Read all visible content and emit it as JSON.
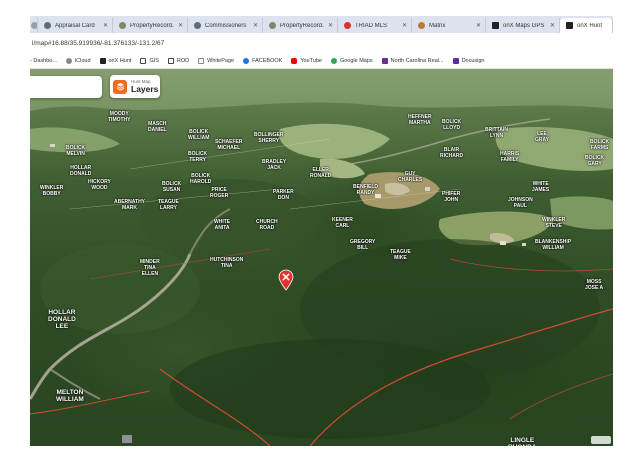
{
  "browser": {
    "tabs": [
      {
        "label": "",
        "icon": "page-icon",
        "color": "#9aa3ad"
      },
      {
        "label": "Appraisal Card",
        "icon": "globe-icon",
        "color": "#5f6b7a"
      },
      {
        "label": "PropertyRecord.a",
        "icon": "county-seal-icon",
        "color": "#7a8a6a"
      },
      {
        "label": "Commissioners",
        "icon": "globe-icon",
        "color": "#5f6b7a"
      },
      {
        "label": "PropertyRecord.a",
        "icon": "county-seal-icon",
        "color": "#7a8a6a"
      },
      {
        "label": "TRIAD MLS",
        "icon": "triad-icon",
        "color": "#d9342b"
      },
      {
        "label": "Matrix",
        "icon": "matrix-icon",
        "color": "#c0782b"
      },
      {
        "label": "onX Maps GPS H",
        "icon": "onx-icon",
        "color": "#222222"
      },
      {
        "label": "onX Hunt",
        "icon": "onx-icon",
        "color": "#222222",
        "active": true
      }
    ],
    "url": "l/map#16.88/35.919936/-81.376133/-131.2/67",
    "bookmarks": [
      {
        "label": "- Dashbo...",
        "icon": "dashboard-icon",
        "color": "#3b6fb6"
      },
      {
        "label": "iCloud",
        "icon": "apple-icon",
        "color": "#888888"
      },
      {
        "label": "onX Hunt",
        "icon": "onx-icon",
        "color": "#222222"
      },
      {
        "label": "GIS",
        "icon": "folder-icon",
        "color": "#444444"
      },
      {
        "label": "ROD",
        "icon": "folder-icon",
        "color": "#444444"
      },
      {
        "label": "WhitePage",
        "icon": "whitepages-icon",
        "color": "#ffffff"
      },
      {
        "label": "FACEBOOK",
        "icon": "facebook-icon",
        "color": "#1877f2"
      },
      {
        "label": "YouTube",
        "icon": "youtube-icon",
        "color": "#ff0000"
      },
      {
        "label": "Google Maps",
        "icon": "google-maps-icon",
        "color": "#34a853"
      },
      {
        "label": "North Carolina Real...",
        "icon": "nc-realtors-icon",
        "color": "#6b2d8f"
      },
      {
        "label": "Docusign",
        "icon": "docusign-icon",
        "color": "#5a2ea6"
      }
    ]
  },
  "map": {
    "layers_button": {
      "sub": "Hunt Map",
      "title": "Layers"
    },
    "marker_color": "#e5312b",
    "labels": [
      {
        "text": "MOODY\nTIMOTHY",
        "big": false
      },
      {
        "text": "MASCH\nDANIEL",
        "big": false
      },
      {
        "text": "BOLICK\nWILLIAM",
        "big": false
      },
      {
        "text": "SCHAEFER\nMICHAEL",
        "big": false
      },
      {
        "text": "BOLLINGER\nSHERRY",
        "big": false
      },
      {
        "text": "BOLICK\nTERRY",
        "big": false
      },
      {
        "text": "BRADLEY\nJACK",
        "big": false
      },
      {
        "text": "HEFFNER\nMARTHA",
        "big": false
      },
      {
        "text": "BOLICK\nLLOYD",
        "big": false
      },
      {
        "text": "BRITTAIN\nLYNN",
        "big": false
      },
      {
        "text": "LEE\nGRAY",
        "big": false
      },
      {
        "text": "BOLICK\nFARMS",
        "big": false
      },
      {
        "text": "BOLICK\nHAROLD",
        "big": false
      },
      {
        "text": "HICKORY\nWOOD",
        "big": false
      },
      {
        "text": "HOLLAR\nDONALD",
        "big": false
      },
      {
        "text": "ELLER\nRONALD",
        "big": false
      },
      {
        "text": "GUY\nCHARLES",
        "big": false
      },
      {
        "text": "BENFIELD\nRANDY",
        "big": false
      },
      {
        "text": "BLAIR\nRICHARD",
        "big": false
      },
      {
        "text": "HARRIS\nFAMILY",
        "big": false
      },
      {
        "text": "BOLICK\nGARY",
        "big": false
      },
      {
        "text": "PHIFER\nJOHN",
        "big": false
      },
      {
        "text": "JOHNSON\nPAUL",
        "big": false
      },
      {
        "text": "WHITE\nJAMES",
        "big": false
      },
      {
        "text": "TEAGUE\nLARRY",
        "big": false
      },
      {
        "text": "PRICE\nROGER",
        "big": false
      },
      {
        "text": "ABERNATHY\nMARK",
        "big": false
      },
      {
        "text": "WINKLER\nBOBBY",
        "big": false
      },
      {
        "text": "BOLICK\nSUSAN",
        "big": false
      },
      {
        "text": "PARKER\nDON",
        "big": false
      },
      {
        "text": "KEENER\nCARL",
        "big": false
      },
      {
        "text": "WINKLER\nSTEVE",
        "big": false
      },
      {
        "text": "GREGORY\nBILL",
        "big": false
      },
      {
        "text": "TEAGUE\nMIKE",
        "big": false
      },
      {
        "text": "BLANKENSHIP\nWILLIAM",
        "big": false
      },
      {
        "text": "MOSS\nJOSE A",
        "big": false
      },
      {
        "text": "MINDER\nTINA\nELLEN",
        "big": false
      },
      {
        "text": "HUTCHINSON\nTINA",
        "big": false
      },
      {
        "text": "HOLLAR\nDONALD\nLEE",
        "big": true
      },
      {
        "text": "MELTON\nWILLIAM",
        "big": true
      },
      {
        "text": "LINGLE\nRHONDA",
        "big": true
      },
      {
        "text": "CHURCH\nROAD",
        "big": false
      },
      {
        "text": "WHITE\nANITA",
        "big": false
      },
      {
        "text": "BOLICK\nMELVIN",
        "big": false
      }
    ]
  }
}
